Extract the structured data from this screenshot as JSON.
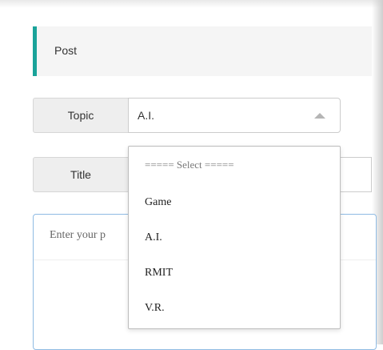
{
  "post": {
    "header_label": "Post"
  },
  "topic": {
    "label": "Topic",
    "selected": "A.I."
  },
  "title": {
    "label": "Title"
  },
  "content": {
    "placeholder": "Enter your p"
  },
  "dropdown": {
    "options": [
      "===== Select =====",
      "Game",
      "A.I.",
      "RMIT",
      "V.R."
    ]
  },
  "colors": {
    "accent": "#1aa39a",
    "focus_border": "#8fbbe3",
    "addon_bg": "#eeeeee",
    "header_bg": "#f5f5f5"
  },
  "icons": {
    "select_caret": "caret-up-icon"
  }
}
